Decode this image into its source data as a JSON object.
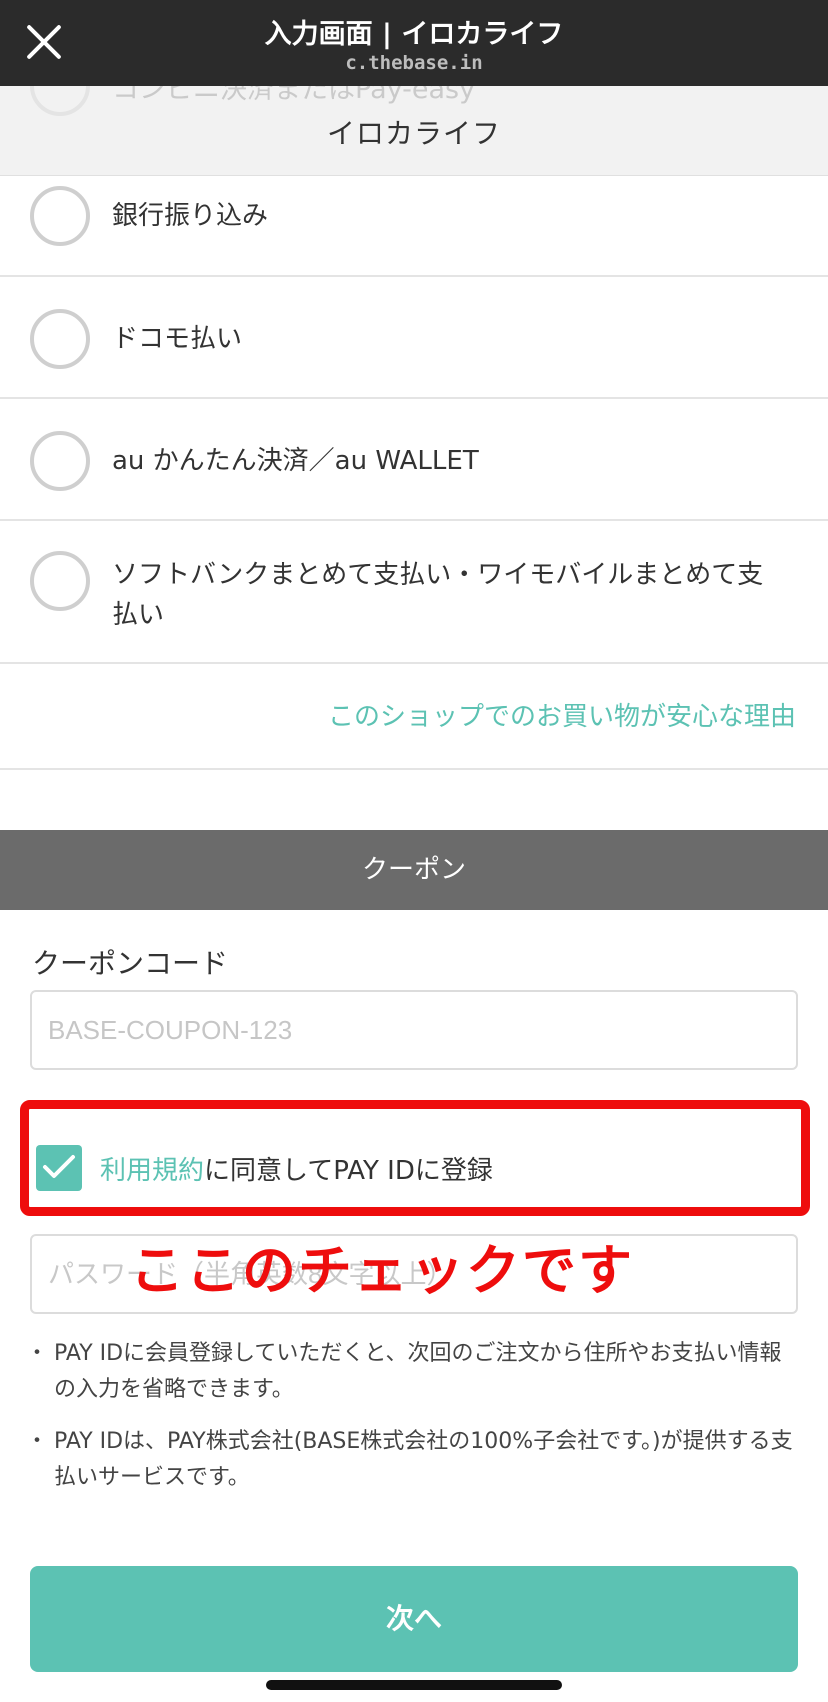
{
  "browser": {
    "title": "入力画面 | イロカライフ",
    "domain": "c.thebase.in"
  },
  "shop": {
    "name": "イロカライフ",
    "partial_option_label": "コンビニ決済またはPay-easy"
  },
  "payment_options": [
    {
      "label": "銀行振り込み",
      "selected": false
    },
    {
      "label": "ドコモ払い",
      "selected": false
    },
    {
      "label": "au かんたん決済／au WALLET",
      "selected": false
    },
    {
      "label": "ソフトバンクまとめて支払い・ワイモバイルまとめて支払い",
      "selected": false
    }
  ],
  "safe_shopping_link": "このショップでのお買い物が安心な理由",
  "coupon": {
    "section_title": "クーポン",
    "field_label": "クーポンコード",
    "placeholder": "BASE-COUPON-123",
    "value": ""
  },
  "pay_id": {
    "checked": true,
    "terms_link": "利用規約",
    "agree_suffix": "に同意してPAY IDに登録",
    "password_placeholder": "パスワード（半角英数8文字以上）",
    "notes": [
      "PAY IDに会員登録していただくと、次回のご注文から住所やお支払い情報の入力を省略できます。",
      "PAY IDは、PAY株式会社(BASE株式会社の100%子会社です。)が提供する支払いサービスです。"
    ]
  },
  "annotation_text": "ここのチェックです",
  "next_button": "次へ",
  "colors": {
    "accent": "#5cc2b3",
    "highlight": "#ee0d0d",
    "topbar": "#2b2b2b",
    "section_header": "#6b6b6b"
  }
}
